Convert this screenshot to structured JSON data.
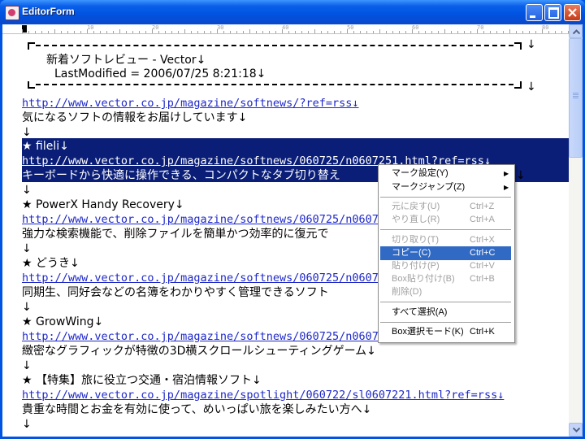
{
  "window": {
    "title": "EditorForm"
  },
  "ruler": {
    "labels": [
      "0",
      "10",
      "20",
      "30",
      "40",
      "50",
      "60",
      "70",
      "80"
    ]
  },
  "editor": {
    "header_title": "新着ソフトレビュー - Vector↓",
    "header_modified": "LastModified = 2006/07/25 8:21:18↓",
    "lines": [
      {
        "text": "http://www.vector.co.jp/magazine/softnews/?ref=rss",
        "mark": "↓"
      },
      {
        "text": "気になるソフトの情報をお届けしています↓",
        "mark": ""
      },
      {
        "text": "↓",
        "mark": ""
      },
      {
        "text": "★ fileli↓",
        "mark": ""
      },
      {
        "text": "http://www.vector.co.jp/magazine/softnews/060725/n0607251.html?ref=rss",
        "mark": "↓"
      },
      {
        "text": "キーボードから快適に操作できる、コンパクトなタブ切り替え",
        "mark": "↓"
      },
      {
        "text": "↓",
        "mark": ""
      },
      {
        "text": "★ PowerX Handy Recovery↓",
        "mark": ""
      },
      {
        "text": "http://www.vector.co.jp/magazine/softnews/060725/n0607",
        "mark": ""
      },
      {
        "text": "強力な検索機能で、削除ファイルを簡単かつ効率的に復元で",
        "mark": ""
      },
      {
        "text": "↓",
        "mark": ""
      },
      {
        "text": "★ どうき↓",
        "mark": ""
      },
      {
        "text": "http://www.vector.co.jp/magazine/softnews/060725/n0607",
        "mark": ""
      },
      {
        "text": "同期生、同好会などの名簿をわかりやすく管理できるソフト",
        "mark": ""
      },
      {
        "text": "↓",
        "mark": ""
      },
      {
        "text": "★ GrowWing↓",
        "mark": ""
      },
      {
        "text": "http://www.vector.co.jp/magazine/softnews/060725/n0607",
        "mark": ""
      },
      {
        "text": "緻密なグラフィックが特徴の3D横スクロールシューティングゲーム↓",
        "mark": ""
      },
      {
        "text": "↓",
        "mark": ""
      },
      {
        "text": "★ 【特集】旅に役立つ交通・宿泊情報ソフト↓",
        "mark": ""
      },
      {
        "text": "http://www.vector.co.jp/magazine/spotlight/060722/sl0607221.html?ref=rss",
        "mark": "↓"
      },
      {
        "text": "貴重な時間とお金を有効に使って、めいっぱい旅を楽しみたい方へ↓",
        "mark": ""
      },
      {
        "text": "↓",
        "mark": ""
      }
    ],
    "box_arrow": "↓"
  },
  "context_menu": {
    "items": [
      {
        "label": "マーク設定(Y)",
        "shortcut": "",
        "submenu": "▶"
      },
      {
        "label": "マークジャンプ(Z)",
        "shortcut": "",
        "submenu": "▶"
      },
      {
        "label": "元に戻す(U)",
        "shortcut": "Ctrl+Z",
        "submenu": ""
      },
      {
        "label": "やり直し(R)",
        "shortcut": "Ctrl+A",
        "submenu": ""
      },
      {
        "label": "切り取り(T)",
        "shortcut": "Ctrl+X",
        "submenu": ""
      },
      {
        "label": "コピー(C)",
        "shortcut": "Ctrl+C",
        "submenu": ""
      },
      {
        "label": "貼り付け(P)",
        "shortcut": "Ctrl+V",
        "submenu": ""
      },
      {
        "label": "Box貼り付け(B)",
        "shortcut": "Ctrl+B",
        "submenu": ""
      },
      {
        "label": "削除(D)",
        "shortcut": "",
        "submenu": ""
      },
      {
        "label": "すべて選択(A)",
        "shortcut": "",
        "submenu": ""
      },
      {
        "label": "Box選択モード(K)",
        "shortcut": "Ctrl+K",
        "submenu": ""
      }
    ]
  },
  "colors": {
    "selection": "#0a1e78",
    "link": "#1e28c8",
    "menu_highlight": "#316ac5",
    "titlebar": "#0054e3"
  }
}
